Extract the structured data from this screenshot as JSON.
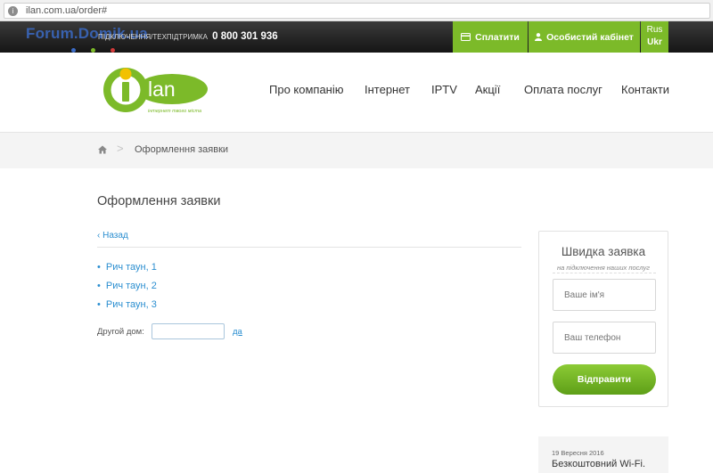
{
  "browser": {
    "url": "ilan.com.ua/order#"
  },
  "watermark": {
    "text": "Forum.Domik.ua"
  },
  "topbar": {
    "support_label": "ПІДКЛЮЧЕННЯ/ТЕХПІДТРИМКА",
    "phone": "0 800 301 936",
    "pay_label": "Сплатити",
    "cabinet_label": "Особистий кабінет",
    "lang_rus": "Rus",
    "lang_ukr": "Ukr"
  },
  "logo": {
    "text": "lan",
    "tagline": "інтернет твого міста",
    "brand_color": "#7cba29"
  },
  "nav": [
    "Про компанію",
    "Інтернет",
    "IPTV",
    "Акції",
    "Оплата послуг",
    "Контакти"
  ],
  "breadcrumb": {
    "current": "Оформлення заявки"
  },
  "main": {
    "title": "Оформлення заявки",
    "back_label": "Назад",
    "items": [
      "Рич таун, 1",
      "Рич таун, 2",
      "Рич таун, 3"
    ],
    "other_label": "Другой дом:",
    "other_value": "",
    "ok_label": "да",
    "link_color": "#2a8ed0"
  },
  "quick_form": {
    "title": "Швидка заявка",
    "subtitle": "на підключення наших послуг",
    "name_placeholder": "Ваше ім'я",
    "phone_placeholder": "Ваш телефон",
    "submit_label": "Відправити"
  },
  "news": {
    "date": "19 Вересня 2016",
    "headline": "Безкоштовний Wi-Fi."
  }
}
